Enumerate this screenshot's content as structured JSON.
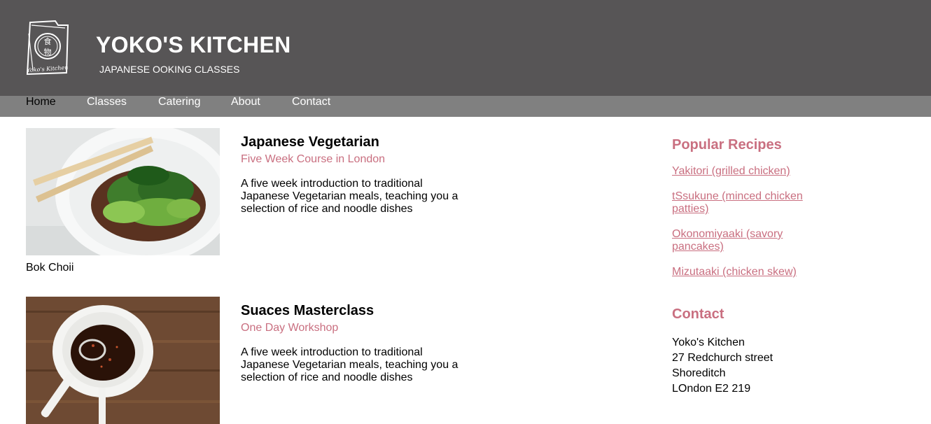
{
  "header": {
    "title": "YOKO'S KITCHEN",
    "subtitle": "JAPANESE OOKING CLASSES",
    "logo_text": "Yoko's Kitchen",
    "logo_glyph": "食物",
    "background": "#575556"
  },
  "nav": {
    "items": [
      {
        "label": "Home"
      },
      {
        "label": "Classes"
      },
      {
        "label": "Catering"
      },
      {
        "label": "About"
      },
      {
        "label": "Contact"
      }
    ],
    "active": "Home",
    "background": "#808080"
  },
  "courses": [
    {
      "image": "bok-choy-image",
      "caption": "Bok Choii",
      "title": "Japanese Vegetarian",
      "subtitle": "Five Week Course in London",
      "description": "A five week introduction to traditional Japanese Vegetarian meals, teaching you a selection of rice and noodle dishes"
    },
    {
      "image": "sauce-bowl-image",
      "caption": "",
      "title": "Suaces Masterclass",
      "subtitle": "One Day Workshop",
      "description": "A five week introduction to traditional Japanese Vegetarian meals, teaching you a selection of rice and noodle dishes"
    }
  ],
  "sidebar": {
    "recipes_heading": "Popular Recipes",
    "recipes": [
      {
        "label": "Yakitori (grilled chicken)"
      },
      {
        "label": "tSsukune (minced chicken patties)"
      },
      {
        "label": "Okonomiyaaki (savory pancakes)"
      },
      {
        "label": "Mizutaaki (chicken skew)"
      }
    ],
    "contact_heading": "Contact",
    "address": [
      "Yoko's Kitchen",
      "27 Redchurch street",
      "Shoreditch",
      "LOndon E2 219"
    ]
  },
  "colors": {
    "accent": "#c96f80",
    "text": "#000000"
  }
}
